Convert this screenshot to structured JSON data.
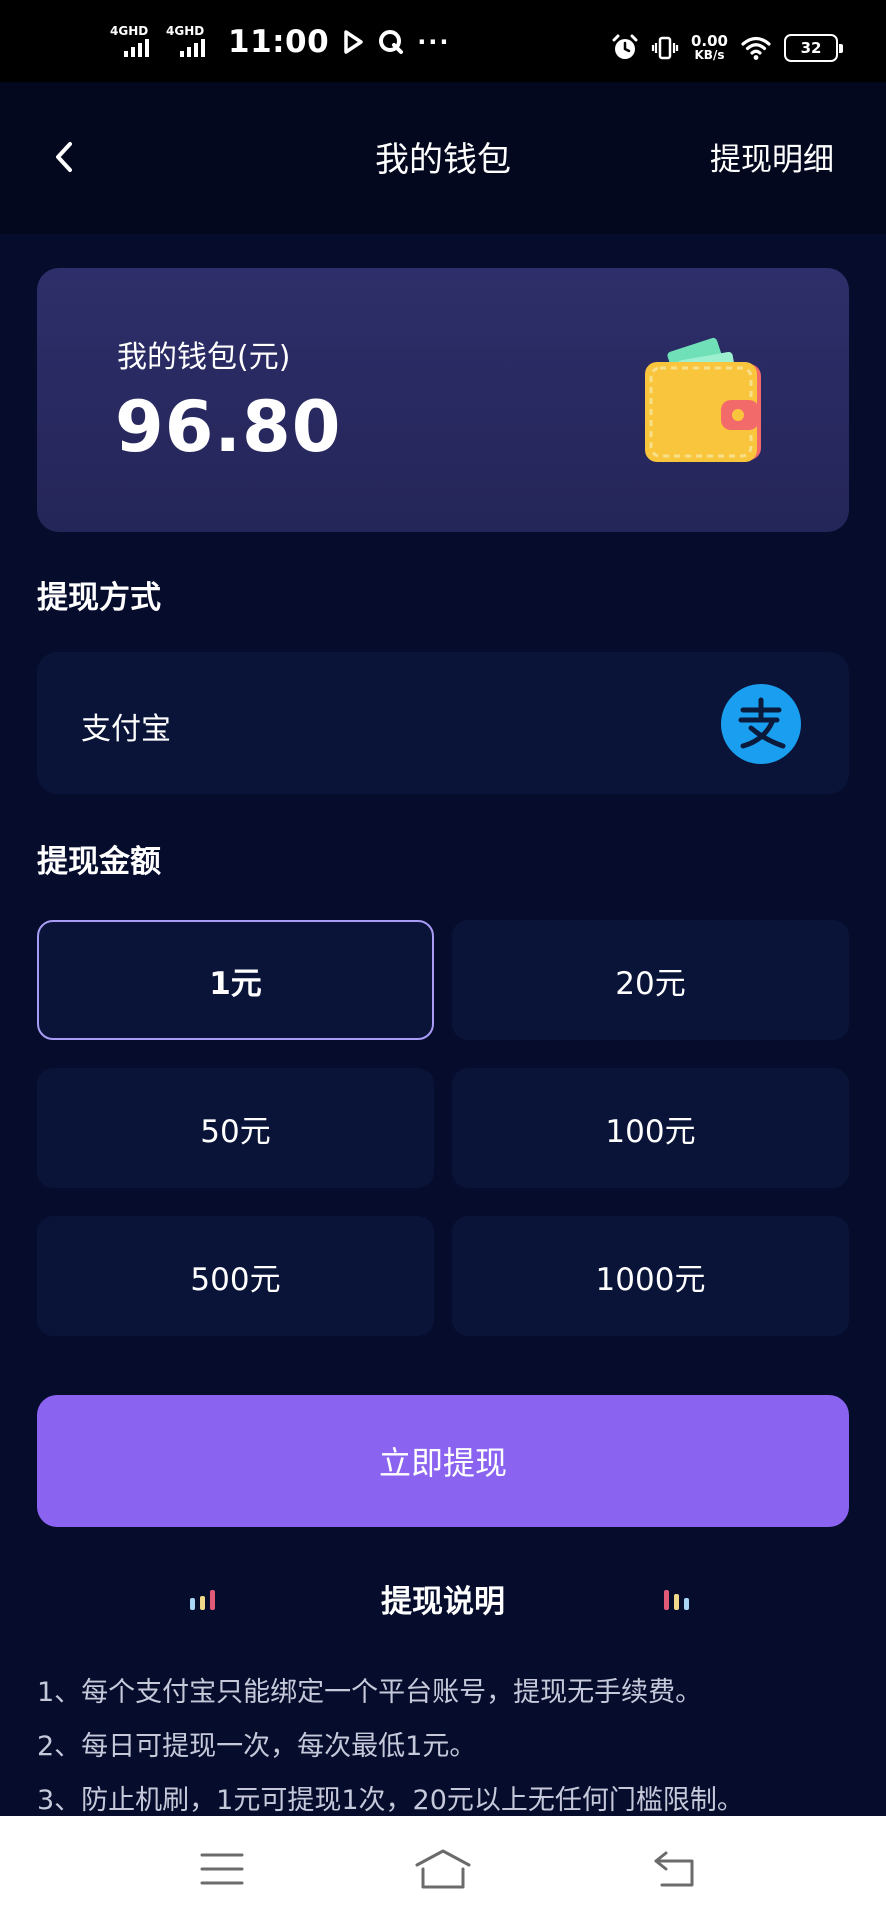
{
  "status_bar": {
    "signal1_label": "4GHD",
    "signal2_label": "4GHD",
    "time": "11:00",
    "more": "···",
    "net_speed_value": "0.00",
    "net_speed_unit": "KB/s",
    "battery_level": "32"
  },
  "header": {
    "title": "我的钱包",
    "right_link": "提现明细",
    "back_icon": "chevron-left-icon"
  },
  "wallet": {
    "label": "我的钱包(元)",
    "balance": "96.80",
    "icon": "wallet-icon"
  },
  "method_section": {
    "title": "提现方式",
    "method_name": "支付宝",
    "method_icon": "alipay-icon"
  },
  "amount_section": {
    "title": "提现金额",
    "options": [
      "1元",
      "20元",
      "50元",
      "100元",
      "500元",
      "1000元"
    ],
    "selected": "1元"
  },
  "submit_label": "立即提现",
  "notes": {
    "title": "提现说明",
    "items": [
      "1、每个支付宝只能绑定一个平台账号，提现无手续费。",
      "2、每日可提现一次，每次最低1元。",
      "3、防止机刷，1元可提现1次，20元以上无任何门槛限制。"
    ]
  },
  "nav": {
    "menu_icon": "menu-icon",
    "home_icon": "home-icon",
    "back_icon": "back-arrow-icon"
  },
  "colors": {
    "background": "#050c2c",
    "header_bg": "#03081f",
    "card_bg": "#0a1438",
    "wallet_card": "#2e2e6a",
    "accent_purple": "#8b63f1",
    "selected_border": "#a99cf4",
    "alipay_blue": "#1a9ff0"
  }
}
